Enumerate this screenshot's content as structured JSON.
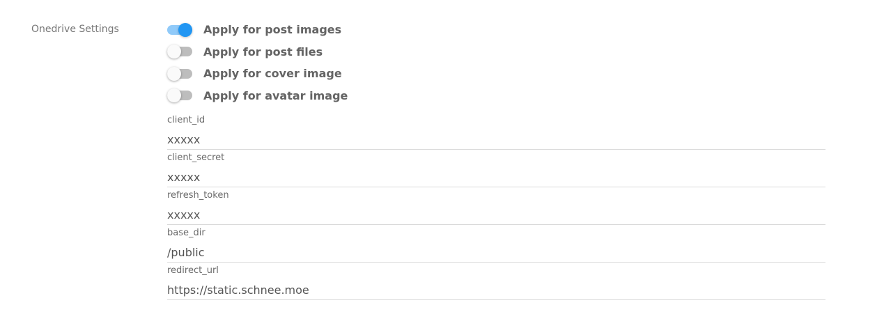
{
  "section": {
    "label": "Onedrive Settings"
  },
  "toggles": [
    {
      "label": "Apply for post images",
      "checked": true
    },
    {
      "label": "Apply for post files",
      "checked": false
    },
    {
      "label": "Apply for cover image",
      "checked": false
    },
    {
      "label": "Apply for avatar image",
      "checked": false
    }
  ],
  "fields": [
    {
      "label": "client_id",
      "value": "xxxxx"
    },
    {
      "label": "client_secret",
      "value": "xxxxx"
    },
    {
      "label": "refresh_token",
      "value": "xxxxx"
    },
    {
      "label": "base_dir",
      "value": "/public"
    },
    {
      "label": "redirect_url",
      "value": "https://static.schnee.moe"
    }
  ],
  "colors": {
    "toggle_on_thumb": "#2196f3",
    "toggle_on_track": "#90caf9",
    "toggle_off_track": "#bdbdbd",
    "toggle_off_thumb": "#fafafa"
  }
}
